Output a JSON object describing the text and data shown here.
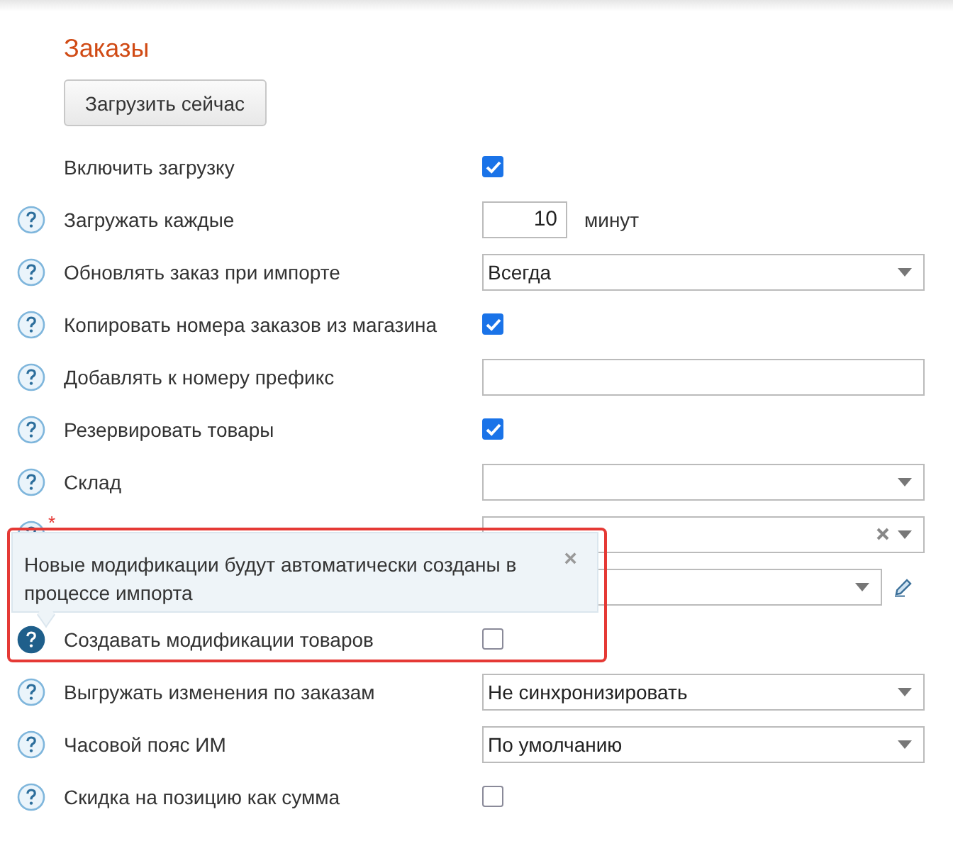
{
  "section_title": "Заказы",
  "load_button": "Загрузить сейчас",
  "rows": [
    {
      "kind": "checkbox",
      "label": "Включить загрузку",
      "help": false,
      "checked": true
    },
    {
      "kind": "number",
      "label": "Загружать каждые",
      "help": true,
      "value": "10",
      "unit": "минут"
    },
    {
      "kind": "select",
      "label": "Обновлять заказ при импорте",
      "help": true,
      "value": "Всегда"
    },
    {
      "kind": "checkbox",
      "label": "Копировать номера заказов из магазина",
      "help": true,
      "checked": true
    },
    {
      "kind": "text",
      "label": "Добавлять к номеру префикс",
      "help": true
    },
    {
      "kind": "checkbox",
      "label": "Резервировать товары",
      "help": true,
      "checked": true
    },
    {
      "kind": "select",
      "label": "Склад",
      "help": true
    },
    {
      "kind": "select",
      "help": true,
      "required_mark": "*",
      "clearable": true
    },
    {
      "kind": "select",
      "help": false,
      "editable": true
    },
    {
      "kind": "checkbox",
      "label": "Создавать модификации товаров",
      "help": true,
      "help_active": true,
      "checked": false
    },
    {
      "kind": "select",
      "label": "Выгружать изменения по заказам",
      "help": true,
      "value": "Не синхронизировать"
    },
    {
      "kind": "select",
      "label": "Часовой пояс ИМ",
      "help": true,
      "value": "По умолчанию"
    },
    {
      "kind": "checkbox",
      "label": "Скидка на позицию как сумма",
      "help": true,
      "checked": false
    }
  ],
  "tooltip": {
    "text": "Новые модификации будут автоматически созданы в процессе импорта",
    "close": "×"
  }
}
